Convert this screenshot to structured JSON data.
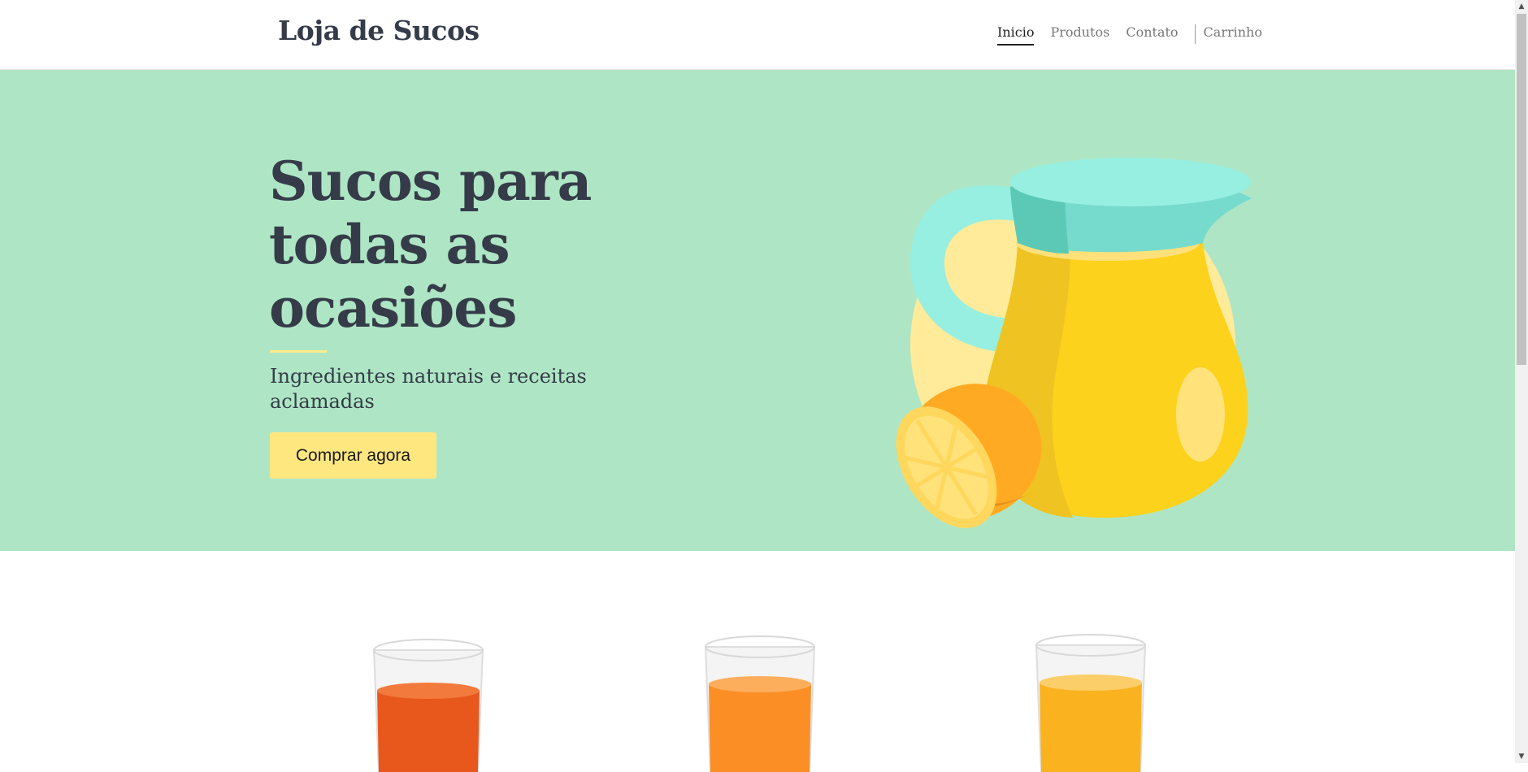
{
  "header": {
    "brand": "Loja de Sucos",
    "nav": [
      {
        "label": "Inicio",
        "active": true
      },
      {
        "label": "Produtos",
        "active": false
      },
      {
        "label": "Contato",
        "active": false
      }
    ],
    "cart_label": "Carrinho"
  },
  "hero": {
    "title": "Sucos para todas as ocasiões",
    "subtitle": "Ingredientes naturais e receitas aclamadas",
    "cta_label": "Comprar agora",
    "illustration_icon": "juice-pitcher-with-orange-icon"
  },
  "products": {
    "items": [
      {
        "icon": "red-orange-juice-glass-icon",
        "color": "#e8571c"
      },
      {
        "icon": "orange-juice-glass-icon",
        "color": "#fb8f25"
      },
      {
        "icon": "yellow-juice-glass-icon",
        "color": "#fbb21f"
      }
    ]
  },
  "colors": {
    "hero_bg": "#aee6c5",
    "text_dark": "#353b48",
    "accent_yellow": "#ffe77f",
    "pitcher_lid": "#96efe0",
    "juice": "#fcd21d"
  }
}
